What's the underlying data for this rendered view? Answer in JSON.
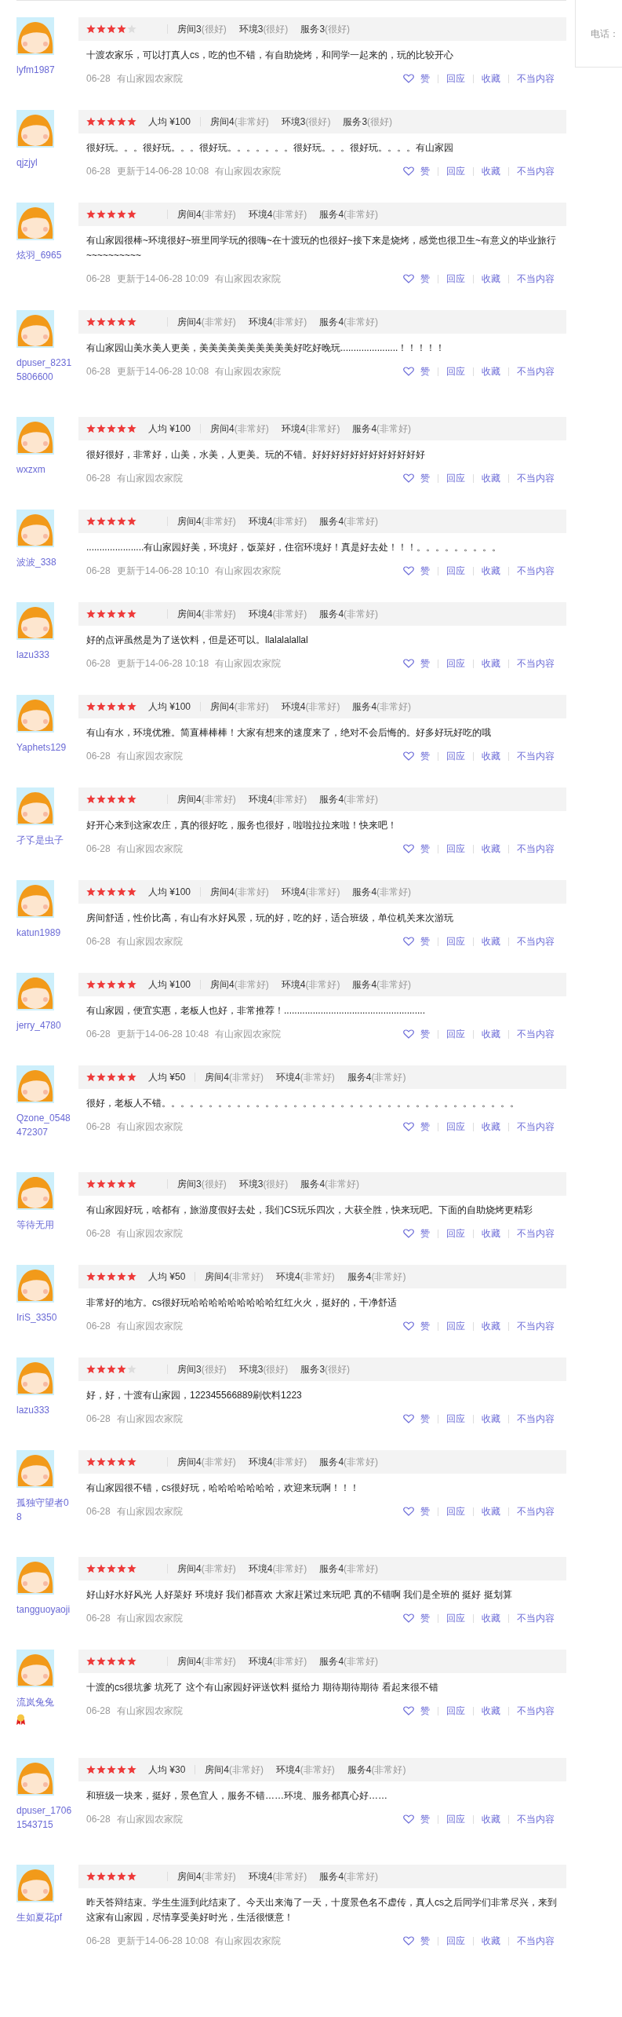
{
  "sidebar": {
    "label": "电话："
  },
  "reviews": [
    {
      "user": {
        "name": "lyfm1987",
        "medal": false
      },
      "stars": 4,
      "scores": [
        {
          "label": "房间3",
          "grade": "(很好)"
        },
        {
          "label": "环境3",
          "grade": "(很好)"
        },
        {
          "label": "服务3",
          "grade": "(很好)"
        }
      ],
      "text": "十渡农家乐，可以打真人cs，吃的也不错，有自助烧烤，和同学一起来的，玩的比较开心",
      "date": "06-28",
      "shop": "有山家园农家院",
      "actions": [
        "赞",
        "回应",
        "收藏",
        "不当内容"
      ]
    },
    {
      "user": {
        "name": "qjzjyl",
        "medal": false
      },
      "stars": 5,
      "price": "人均 ¥100",
      "scores": [
        {
          "label": "房间4",
          "grade": "(非常好)"
        },
        {
          "label": "环境3",
          "grade": "(很好)"
        },
        {
          "label": "服务3",
          "grade": "(很好)"
        }
      ],
      "text": "很好玩。。。很好玩。。。很好玩。。。。。。。很好玩。。。很好玩。。。。有山家园",
      "date": "06-28",
      "updated": "更新于14-06-28 10:08",
      "shop": "有山家园农家院",
      "actions": [
        "赞",
        "回应",
        "收藏",
        "不当内容"
      ]
    },
    {
      "user": {
        "name": "炫羽_6965",
        "medal": false
      },
      "stars": 5,
      "scores": [
        {
          "label": "房间4",
          "grade": "(非常好)"
        },
        {
          "label": "环境4",
          "grade": "(非常好)"
        },
        {
          "label": "服务4",
          "grade": "(非常好)"
        }
      ],
      "text": "有山家园很棒~环境很好~班里同学玩的很嗨~在十渡玩的也很好~接下来是烧烤，感觉也很卫生~有意义的毕业旅行~~~~~~~~~~",
      "date": "06-28",
      "updated": "更新于14-06-28 10:09",
      "shop": "有山家园农家院",
      "actions": [
        "赞",
        "回应",
        "收藏",
        "不当内容"
      ]
    },
    {
      "user": {
        "name": "dpuser_82315806600",
        "medal": false
      },
      "stars": 5,
      "scores": [
        {
          "label": "房间4",
          "grade": "(非常好)"
        },
        {
          "label": "环境4",
          "grade": "(非常好)"
        },
        {
          "label": "服务4",
          "grade": "(非常好)"
        }
      ],
      "text": "有山家园山美水美人更美，美美美美美美美美美美好吃好晚玩......................！！！！！",
      "date": "06-28",
      "updated": "更新于14-06-28 10:08",
      "shop": "有山家园农家院",
      "actions": [
        "赞",
        "回应",
        "收藏",
        "不当内容"
      ]
    },
    {
      "user": {
        "name": "wxzxm",
        "medal": false
      },
      "stars": 5,
      "price": "人均 ¥100",
      "scores": [
        {
          "label": "房间4",
          "grade": "(非常好)"
        },
        {
          "label": "环境4",
          "grade": "(非常好)"
        },
        {
          "label": "服务4",
          "grade": "(非常好)"
        }
      ],
      "text": "很好很好，非常好，山美，水美，人更美。玩的不错。好好好好好好好好好好好好",
      "date": "06-28",
      "shop": "有山家园农家院",
      "actions": [
        "赞",
        "回应",
        "收藏",
        "不当内容"
      ]
    },
    {
      "user": {
        "name": "波波_338",
        "medal": false
      },
      "stars": 5,
      "scores": [
        {
          "label": "房间4",
          "grade": "(非常好)"
        },
        {
          "label": "环境4",
          "grade": "(非常好)"
        },
        {
          "label": "服务4",
          "grade": "(非常好)"
        }
      ],
      "text": "......................有山家园好美，环境好，饭菜好，住宿环境好！真是好去处！！！。。。。。。。。。",
      "date": "06-28",
      "updated": "更新于14-06-28 10:10",
      "shop": "有山家园农家院",
      "actions": [
        "赞",
        "回应",
        "收藏",
        "不当内容"
      ]
    },
    {
      "user": {
        "name": "lazu333",
        "medal": false
      },
      "stars": 5,
      "scores": [
        {
          "label": "房间4",
          "grade": "(非常好)"
        },
        {
          "label": "环境4",
          "grade": "(非常好)"
        },
        {
          "label": "服务4",
          "grade": "(非常好)"
        }
      ],
      "text": "好的点评虽然是为了送饮料，但是还可以。llalalalallal",
      "date": "06-28",
      "updated": "更新于14-06-28 10:18",
      "shop": "有山家园农家院",
      "actions": [
        "赞",
        "回应",
        "收藏",
        "不当内容"
      ]
    },
    {
      "user": {
        "name": "Yaphets129",
        "medal": false
      },
      "stars": 5,
      "price": "人均 ¥100",
      "scores": [
        {
          "label": "房间4",
          "grade": "(非常好)"
        },
        {
          "label": "环境4",
          "grade": "(非常好)"
        },
        {
          "label": "服务4",
          "grade": "(非常好)"
        }
      ],
      "text": "有山有水，环境优雅。简直棒棒棒！大家有想来的速度来了，绝对不会后悔的。好多好玩好吃的哦",
      "date": "06-28",
      "shop": "有山家园农家院",
      "actions": [
        "赞",
        "回应",
        "收藏",
        "不当内容"
      ]
    },
    {
      "user": {
        "name": "孑孓是虫子",
        "medal": false
      },
      "stars": 5,
      "scores": [
        {
          "label": "房间4",
          "grade": "(非常好)"
        },
        {
          "label": "环境4",
          "grade": "(非常好)"
        },
        {
          "label": "服务4",
          "grade": "(非常好)"
        }
      ],
      "text": "好开心来到这家农庄，真的很好吃，服务也很好，啦啦拉拉来啦！快来吧！",
      "date": "06-28",
      "shop": "有山家园农家院",
      "actions": [
        "赞",
        "回应",
        "收藏",
        "不当内容"
      ]
    },
    {
      "user": {
        "name": "katun1989",
        "medal": false
      },
      "stars": 5,
      "price": "人均 ¥100",
      "scores": [
        {
          "label": "房间4",
          "grade": "(非常好)"
        },
        {
          "label": "环境4",
          "grade": "(非常好)"
        },
        {
          "label": "服务4",
          "grade": "(非常好)"
        }
      ],
      "text": "房间舒适，性价比高，有山有水好风景，玩的好，吃的好，适合班级，单位机关来次游玩",
      "date": "06-28",
      "shop": "有山家园农家院",
      "actions": [
        "赞",
        "回应",
        "收藏",
        "不当内容"
      ]
    },
    {
      "user": {
        "name": "jerry_4780",
        "medal": false
      },
      "stars": 5,
      "price": "人均 ¥100",
      "scores": [
        {
          "label": "房间4",
          "grade": "(非常好)"
        },
        {
          "label": "环境4",
          "grade": "(非常好)"
        },
        {
          "label": "服务4",
          "grade": "(非常好)"
        }
      ],
      "text": "有山家园，便宜实惠，老板人也好，非常推荐！......................................................",
      "date": "06-28",
      "updated": "更新于14-06-28 10:48",
      "shop": "有山家园农家院",
      "actions": [
        "赞",
        "回应",
        "收藏",
        "不当内容"
      ]
    },
    {
      "user": {
        "name": "Qzone_0548472307",
        "medal": false
      },
      "stars": 5,
      "price": "人均 ¥50",
      "scores": [
        {
          "label": "房间4",
          "grade": "(非常好)"
        },
        {
          "label": "环境4",
          "grade": "(非常好)"
        },
        {
          "label": "服务4",
          "grade": "(非常好)"
        }
      ],
      "text": "很好，老板人不错。。。。。。。。。。。。。。。。。。。。。。。。。。。。。。。。。。。。。。",
      "date": "06-28",
      "shop": "有山家园农家院",
      "actions": [
        "赞",
        "回应",
        "收藏",
        "不当内容"
      ]
    },
    {
      "user": {
        "name": "等待无用",
        "medal": false
      },
      "stars": 5,
      "scores": [
        {
          "label": "房间3",
          "grade": "(很好)"
        },
        {
          "label": "环境3",
          "grade": "(很好)"
        },
        {
          "label": "服务4",
          "grade": "(非常好)"
        }
      ],
      "text": "有山家园好玩，啥都有，旅游度假好去处，我们CS玩乐四次，大获全胜，快来玩吧。下面的自助烧烤更精彩",
      "date": "06-28",
      "shop": "有山家园农家院",
      "actions": [
        "赞",
        "回应",
        "收藏",
        "不当内容"
      ]
    },
    {
      "user": {
        "name": "IriS_3350",
        "medal": false
      },
      "stars": 5,
      "price": "人均 ¥50",
      "scores": [
        {
          "label": "房间4",
          "grade": "(非常好)"
        },
        {
          "label": "环境4",
          "grade": "(非常好)"
        },
        {
          "label": "服务4",
          "grade": "(非常好)"
        }
      ],
      "text": "非常好的地方。cs很好玩哈哈哈哈哈哈哈哈哈红红火火，挺好的，干净舒适",
      "date": "06-28",
      "shop": "有山家园农家院",
      "actions": [
        "赞",
        "回应",
        "收藏",
        "不当内容"
      ]
    },
    {
      "user": {
        "name": "lazu333",
        "medal": false
      },
      "stars": 4,
      "scores": [
        {
          "label": "房间3",
          "grade": "(很好)"
        },
        {
          "label": "环境3",
          "grade": "(很好)"
        },
        {
          "label": "服务3",
          "grade": "(很好)"
        }
      ],
      "text": "好，好，十渡有山家园，122345566889刷饮料1223",
      "date": "06-28",
      "shop": "有山家园农家院",
      "actions": [
        "赞",
        "回应",
        "收藏",
        "不当内容"
      ]
    },
    {
      "user": {
        "name": "孤独守望者08",
        "medal": false
      },
      "stars": 5,
      "scores": [
        {
          "label": "房间4",
          "grade": "(非常好)"
        },
        {
          "label": "环境4",
          "grade": "(非常好)"
        },
        {
          "label": "服务4",
          "grade": "(非常好)"
        }
      ],
      "text": "有山家园很不错，cs很好玩，哈哈哈哈哈哈哈，欢迎来玩啊！！！",
      "date": "06-28",
      "shop": "有山家园农家院",
      "actions": [
        "赞",
        "回应",
        "收藏",
        "不当内容"
      ]
    },
    {
      "user": {
        "name": "tangguoyaoji",
        "medal": false
      },
      "stars": 5,
      "scores": [
        {
          "label": "房间4",
          "grade": "(非常好)"
        },
        {
          "label": "环境4",
          "grade": "(非常好)"
        },
        {
          "label": "服务4",
          "grade": "(非常好)"
        }
      ],
      "text": "好山好水好风光 人好菜好 环境好 我们都喜欢 大家赶紧过来玩吧 真的不错啊 我们是全班的 挺好 挺划算",
      "date": "06-28",
      "shop": "有山家园农家院",
      "actions": [
        "赞",
        "回应",
        "收藏",
        "不当内容"
      ]
    },
    {
      "user": {
        "name": "流岚兔兔",
        "medal": true
      },
      "stars": 5,
      "scores": [
        {
          "label": "房间4",
          "grade": "(非常好)"
        },
        {
          "label": "环境4",
          "grade": "(非常好)"
        },
        {
          "label": "服务4",
          "grade": "(非常好)"
        }
      ],
      "text": "十渡的cs很坑爹 坑死了 这个有山家园好评送饮料 挺给力 期待期待期待 看起来很不错",
      "date": "06-28",
      "shop": "有山家园农家院",
      "actions": [
        "赞",
        "回应",
        "收藏",
        "不当内容"
      ]
    },
    {
      "user": {
        "name": "dpuser_17061543715",
        "medal": false
      },
      "stars": 5,
      "price": "人均 ¥30",
      "scores": [
        {
          "label": "房间4",
          "grade": "(非常好)"
        },
        {
          "label": "环境4",
          "grade": "(非常好)"
        },
        {
          "label": "服务4",
          "grade": "(非常好)"
        }
      ],
      "text": "和班级一块来，挺好，景色宜人，服务不错……环境、服务都真心好……",
      "date": "06-28",
      "shop": "有山家园农家院",
      "actions": [
        "赞",
        "回应",
        "收藏",
        "不当内容"
      ]
    },
    {
      "user": {
        "name": "生如夏花pf",
        "medal": false
      },
      "stars": 5,
      "scores": [
        {
          "label": "房间4",
          "grade": "(非常好)"
        },
        {
          "label": "环境4",
          "grade": "(非常好)"
        },
        {
          "label": "服务4",
          "grade": "(非常好)"
        }
      ],
      "text": "昨天答辩结束。学生生涯到此结束了。今天出来海了一天，十度景色名不虚传，真人cs之后同学们非常尽兴，来到这家有山家园，尽情享受美好时光，生活很惬意！",
      "date": "06-28",
      "updated": "更新于14-06-28 10:08",
      "shop": "有山家园农家院",
      "actions": [
        "赞",
        "回应",
        "收藏",
        "不当内容"
      ]
    }
  ]
}
